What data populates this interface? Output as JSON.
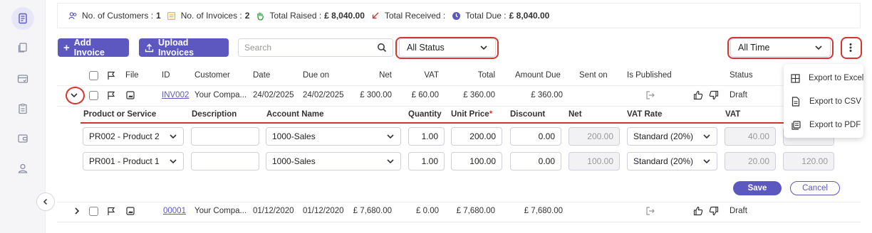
{
  "summary": {
    "customers_label": "No. of Customers :",
    "customers_value": "1",
    "invoices_label": "No. of Invoices :",
    "invoices_value": "2",
    "raised_label": "Total Raised :",
    "raised_value": "£ 8,040.00",
    "received_label": "Total Received :",
    "due_label": "Total Due :",
    "due_value": "£ 8,040.00"
  },
  "toolbar": {
    "add_invoice": "Add Invoice",
    "upload_invoices": "Upload Invoices",
    "search_placeholder": "Search",
    "status_filter": "All Status",
    "time_filter": "All Time"
  },
  "table": {
    "columns": [
      "File",
      "ID",
      "Customer",
      "Date",
      "Due on",
      "Net",
      "VAT",
      "Total",
      "Amount Due",
      "Sent on",
      "Is Published",
      "Status"
    ],
    "rows": [
      {
        "id": "INV002",
        "customer": "Your Compa...",
        "date": "24/02/2025",
        "due_on": "24/02/2025",
        "net": "£ 300.00",
        "vat": "£ 60.00",
        "total": "£ 360.00",
        "amount_due": "£ 360.00",
        "sent_on": "",
        "status": "Draft"
      },
      {
        "id": "00001",
        "customer": "Your Compa...",
        "date": "01/12/2020",
        "due_on": "01/12/2020",
        "net": "£ 7,680.00",
        "vat": "£ 0.00",
        "total": "£ 7,680.00",
        "amount_due": "£ 7,680.00",
        "sent_on": "",
        "status": "Draft"
      }
    ]
  },
  "line_items": {
    "columns": {
      "product": "Product or Service",
      "description": "Description",
      "account": "Account Name",
      "quantity": "Quantity",
      "unit_price": "Unit Price",
      "unit_price_required": "*",
      "discount": "Discount",
      "net": "Net",
      "vat_rate": "VAT Rate",
      "vat": "VAT"
    },
    "items": [
      {
        "product": "PR002 - Product 2",
        "description": "",
        "account": "1000-Sales",
        "quantity": "1.00",
        "unit_price": "200.00",
        "discount": "0.00",
        "net": "200.00",
        "vat_rate": "Standard (20%)",
        "vat": "40.00",
        "total": ""
      },
      {
        "product": "PR001 - Product 1",
        "description": "",
        "account": "1000-Sales",
        "quantity": "1.00",
        "unit_price": "100.00",
        "discount": "0.00",
        "net": "100.00",
        "vat_rate": "Standard (20%)",
        "vat": "20.00",
        "total": "120.00"
      }
    ],
    "save": "Save",
    "cancel": "Cancel"
  },
  "export_menu": {
    "items": [
      {
        "label": "Export to Excel",
        "icon": "table-icon"
      },
      {
        "label": "Export to CSV",
        "icon": "file-icon"
      },
      {
        "label": "Export to PDF",
        "icon": "pdf-icon"
      }
    ]
  },
  "colors": {
    "accent": "#5c58c0",
    "highlight": "#d8342f"
  }
}
